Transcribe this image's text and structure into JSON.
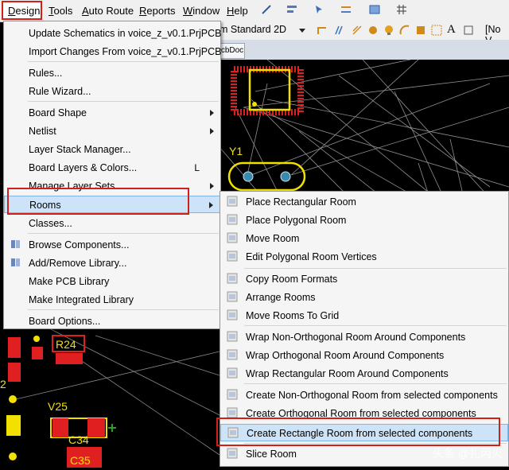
{
  "menubar": {
    "items": [
      {
        "label": "Design",
        "accel": "D",
        "rest": "esign"
      },
      {
        "label": "Tools",
        "accel": "T",
        "rest": "ools"
      },
      {
        "label": "Auto Route",
        "accel": "A",
        "rest": "uto Route"
      },
      {
        "label": "Reports",
        "accel": "R",
        "rest": "eports"
      },
      {
        "label": "Window",
        "accel": "W",
        "rest": "indow"
      },
      {
        "label": "Help",
        "accel": "H",
        "rest": "elp"
      }
    ]
  },
  "toolbar": {
    "view_dropdown": "m Standard 2D",
    "right_text": "[No V"
  },
  "doc_tab": "cbDoc",
  "pcb": {
    "label_y1": "Y1",
    "label_v25": "V25",
    "label_r24": "R24",
    "label_c34": "C34",
    "label_c35": "C35",
    "label_2": "2"
  },
  "design_menu": {
    "items": [
      {
        "label": "Update Schematics in voice_z_v0.1.PrjPCB",
        "submenu": false
      },
      {
        "label": "Import Changes From voice_z_v0.1.PrjPCB",
        "submenu": false
      },
      {
        "label": "Rules...",
        "submenu": false
      },
      {
        "label": "Rule Wizard...",
        "submenu": false
      },
      {
        "label": "Board Shape",
        "submenu": true
      },
      {
        "label": "Netlist",
        "submenu": true
      },
      {
        "label": "Layer Stack Manager...",
        "submenu": false
      },
      {
        "label": "Board Layers & Colors...",
        "submenu": false,
        "shortcut": "L"
      },
      {
        "label": "Manage Layer Sets",
        "submenu": true
      },
      {
        "label": "Rooms",
        "submenu": true,
        "highlighted": true
      },
      {
        "label": "Classes...",
        "submenu": false
      },
      {
        "label": "Browse Components...",
        "submenu": false
      },
      {
        "label": "Add/Remove Library...",
        "submenu": false
      },
      {
        "label": "Make PCB Library",
        "submenu": false
      },
      {
        "label": "Make Integrated Library",
        "submenu": false
      },
      {
        "label": "Board Options...",
        "submenu": false
      }
    ]
  },
  "rooms_menu": {
    "items": [
      {
        "label": "Place Rectangular Room"
      },
      {
        "label": "Place Polygonal Room"
      },
      {
        "label": "Move Room"
      },
      {
        "label": "Edit Polygonal Room Vertices"
      },
      {
        "label": "Copy Room Formats"
      },
      {
        "label": "Arrange Rooms"
      },
      {
        "label": "Move Rooms To Grid"
      },
      {
        "label": "Wrap Non-Orthogonal Room Around Components"
      },
      {
        "label": "Wrap Orthogonal Room Around Components"
      },
      {
        "label": "Wrap Rectangular Room Around Components"
      },
      {
        "label": "Create Non-Orthogonal Room from selected components"
      },
      {
        "label": "Create Orthogonal Room from selected components"
      },
      {
        "label": "Create Rectangle Room from selected components",
        "highlighted": true
      },
      {
        "label": "Slice Room"
      }
    ]
  },
  "watermark": "头条 @扎丙火",
  "colors": {
    "highlight_bg": "#cde3f7",
    "annotation_red": "#d0201a",
    "pcb_yellow": "#f2e000",
    "pcb_red": "#e02020"
  }
}
